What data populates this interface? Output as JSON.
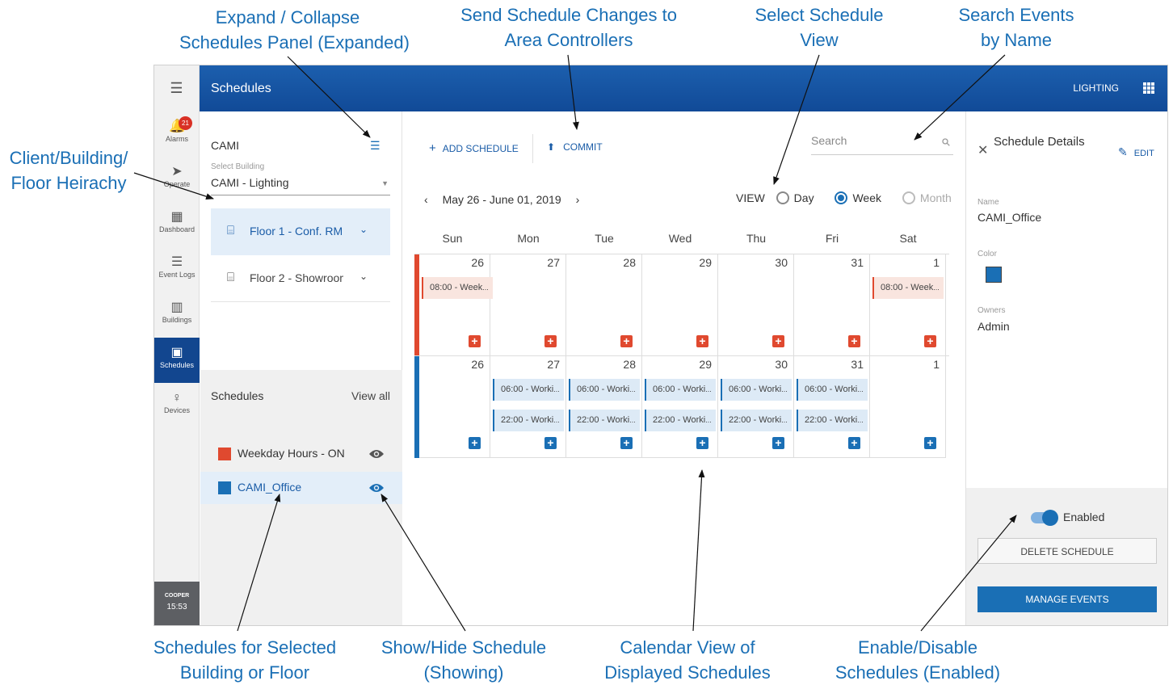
{
  "annotations": {
    "expand_collapse": [
      "Expand / Collapse",
      "Schedules Panel (Expanded)"
    ],
    "send_changes": [
      "Send Schedule Changes to",
      "Area Controllers"
    ],
    "select_view": [
      "Select Schedule",
      "View"
    ],
    "search_events": [
      "Search Events",
      "by Name"
    ],
    "hierarchy": [
      "Client/Building/",
      "Floor Heirachy"
    ],
    "schedules_for": [
      "Schedules for Selected",
      "Building or Floor"
    ],
    "show_hide": [
      "Show/Hide Schedule",
      "(Showing)"
    ],
    "calendar_view": [
      "Calendar View of",
      "Displayed Schedules"
    ],
    "enable_disable": [
      "Enable/Disable",
      "Schedules (Enabled)"
    ]
  },
  "header": {
    "title": "Schedules",
    "lighting": "LIGHTING"
  },
  "nav": {
    "alarm_count": "21",
    "items": [
      {
        "label": "Alarms",
        "icon": "bell-icon"
      },
      {
        "label": "Operate",
        "icon": "send-icon"
      },
      {
        "label": "Dashboard",
        "icon": "dashboard-icon"
      },
      {
        "label": "Event Logs",
        "icon": "list-icon"
      },
      {
        "label": "Buildings",
        "icon": "building-icon"
      },
      {
        "label": "Schedules",
        "icon": "calendar-icon"
      },
      {
        "label": "Devices",
        "icon": "bulb-icon"
      }
    ],
    "brand": "COOPER",
    "time": "15:53"
  },
  "left": {
    "client": "CAMI",
    "select_label": "Select Building",
    "building": "CAMI - Lighting",
    "floors": [
      "Floor 1 - Conf. RM",
      "Floor 2 - Showroom"
    ],
    "schedules_title": "Schedules",
    "view_all": "View all",
    "schedules": [
      {
        "name": "Weekday Hours - ON",
        "color": "#e0492f"
      },
      {
        "name": "CAMI_Office",
        "color": "#1a6fb5"
      }
    ]
  },
  "toolbar": {
    "add": "ADD SCHEDULE",
    "commit": "COMMIT",
    "search_placeholder": "Search"
  },
  "calendar": {
    "range": "May 26 - June 01, 2019",
    "view_label": "VIEW",
    "views": [
      "Day",
      "Week",
      "Month"
    ],
    "selected_view": "Week",
    "days": [
      "Sun",
      "Mon",
      "Tue",
      "Wed",
      "Thu",
      "Fri",
      "Sat"
    ],
    "dates": [
      "26",
      "27",
      "28",
      "29",
      "30",
      "31",
      "1"
    ],
    "rows": [
      {
        "color": "#e0492f",
        "events": [
          "08:00 - Week",
          "",
          "",
          "",
          "",
          "",
          "08:00 - Week"
        ]
      },
      {
        "color": "#1a6fb5",
        "events_a": [
          "",
          "06:00 - Worki",
          "06:00 - Worki",
          "06:00 - Worki",
          "06:00 - Worki",
          "06:00 - Worki",
          ""
        ],
        "events_b": [
          "",
          "22:00 - Worki",
          "22:00 - Worki",
          "22:00 - Worki",
          "22:00 - Worki",
          "22:00 - Worki",
          ""
        ]
      }
    ]
  },
  "details": {
    "title": "Schedule Details",
    "edit": "EDIT",
    "name_label": "Name",
    "name": "CAMI_Office",
    "color_label": "Color",
    "owners_label": "Owners",
    "owner": "Admin",
    "enabled_label": "Enabled",
    "delete": "DELETE SCHEDULE",
    "manage": "MANAGE EVENTS"
  }
}
